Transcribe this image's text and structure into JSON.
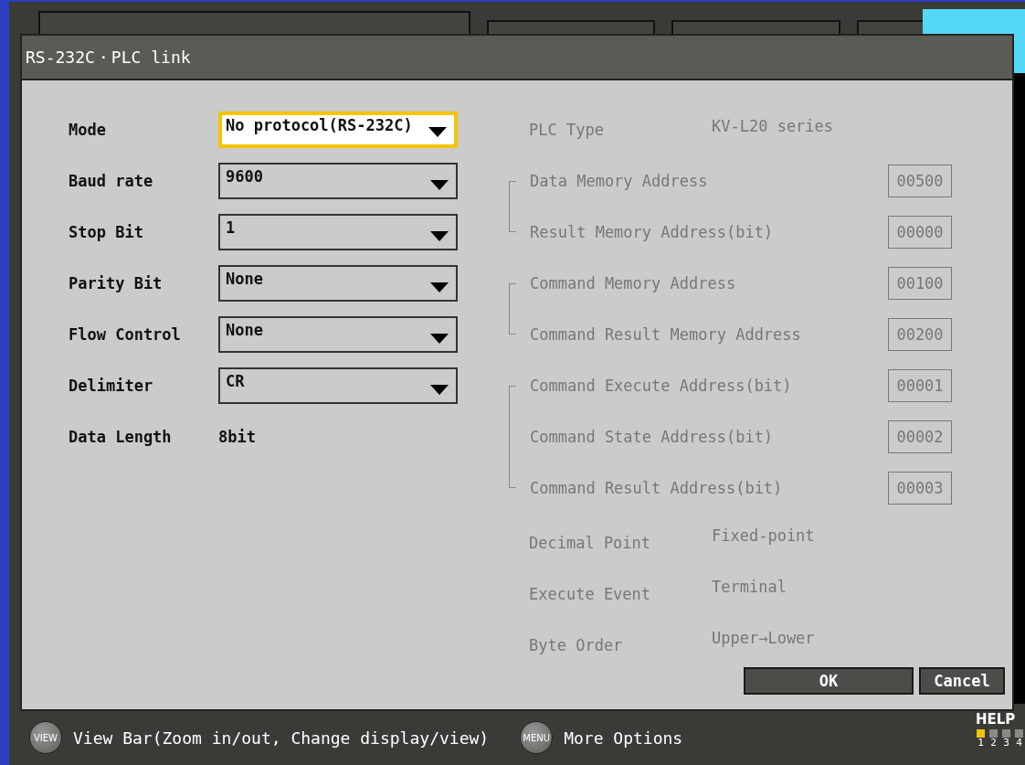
{
  "dialog": {
    "title": "RS-232C・PLC link",
    "left_fields": [
      {
        "label": "Mode",
        "kind": "dropdown",
        "value": "No protocol(RS-232C)",
        "focused": true
      },
      {
        "label": "Baud rate",
        "kind": "dropdown",
        "value": "9600",
        "focused": false
      },
      {
        "label": "Stop Bit",
        "kind": "dropdown",
        "value": "1",
        "focused": false
      },
      {
        "label": "Parity Bit",
        "kind": "dropdown",
        "value": "None",
        "focused": false
      },
      {
        "label": "Flow Control",
        "kind": "dropdown",
        "value": "None",
        "focused": false
      },
      {
        "label": "Delimiter",
        "kind": "dropdown",
        "value": "CR",
        "focused": false
      },
      {
        "label": "Data Length",
        "kind": "text",
        "value": "8bit"
      }
    ],
    "plc_type": {
      "label": "PLC Type",
      "value": "KV-L20 series"
    },
    "address_groups": [
      [
        {
          "label": "Data Memory Address",
          "value": "00500"
        },
        {
          "label": "Result Memory Address(bit)",
          "value": "00000"
        }
      ],
      [
        {
          "label": "Command Memory Address",
          "value": "00100"
        },
        {
          "label": "Command Result Memory Address",
          "value": "00200"
        }
      ],
      [
        {
          "label": "Command Execute Address(bit)",
          "value": "00001"
        },
        {
          "label": "Command State Address(bit)",
          "value": "00002"
        },
        {
          "label": "Command Result Address(bit)",
          "value": "00003"
        }
      ]
    ],
    "settings": [
      {
        "label": "Decimal Point",
        "value": "Fixed-point"
      },
      {
        "label": "Execute Event",
        "value": "Terminal"
      },
      {
        "label": "Byte Order",
        "value": "Upper→Lower"
      }
    ],
    "buttons": [
      {
        "label": "OK"
      },
      {
        "label": "Cancel"
      }
    ]
  },
  "status_bar": {
    "hints": [
      {
        "key": "VIEW",
        "text": "View Bar(Zoom in/out, Change display/view)"
      },
      {
        "key": "MENU",
        "text": "More Options"
      }
    ],
    "help": {
      "label": "HELP",
      "pages": [
        {
          "label": "1",
          "selected": true
        },
        {
          "label": "2",
          "selected": false
        },
        {
          "label": "3",
          "selected": false
        },
        {
          "label": "4",
          "selected": false
        }
      ]
    }
  }
}
